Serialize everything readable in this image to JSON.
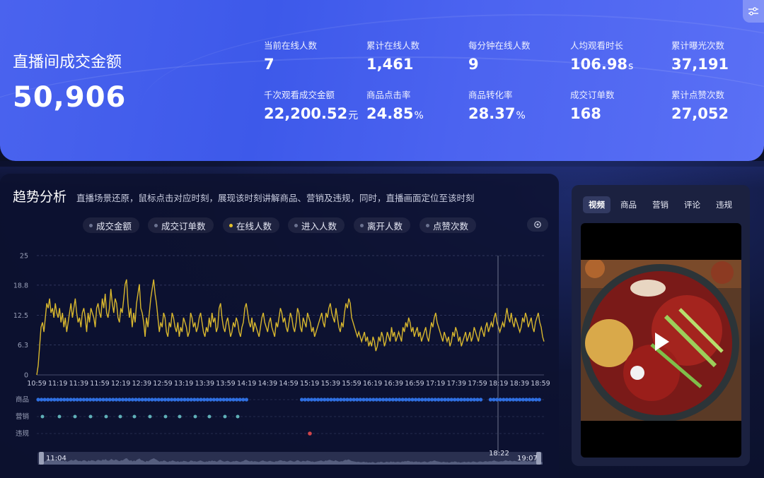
{
  "header": {
    "title": "直播间成交金额",
    "gmv": "50,906",
    "metrics": [
      {
        "label": "当前在线人数",
        "value": "7",
        "unit": ""
      },
      {
        "label": "累计在线人数",
        "value": "1,461",
        "unit": ""
      },
      {
        "label": "每分钟在线人数",
        "value": "9",
        "unit": ""
      },
      {
        "label": "人均观看时长",
        "value": "106.98",
        "unit": "s"
      },
      {
        "label": "累计曝光次数",
        "value": "37,191",
        "unit": ""
      },
      {
        "label": "千次观看成交金额",
        "value": "22,200.52",
        "unit": "元"
      },
      {
        "label": "商品点击率",
        "value": "24.85",
        "unit": "%"
      },
      {
        "label": "商品转化率",
        "value": "28.37",
        "unit": "%"
      },
      {
        "label": "成交订单数",
        "value": "168",
        "unit": ""
      },
      {
        "label": "累计点赞次数",
        "value": "27,052",
        "unit": ""
      }
    ]
  },
  "trend": {
    "title": "趋势分析",
    "description": "直播场景还原，鼠标点击对应时刻，展现该时刻讲解商品、营销及违规，同时，直播画面定位至该时刻",
    "legend": [
      {
        "label": "成交金额",
        "active": false
      },
      {
        "label": "成交订单数",
        "active": false
      },
      {
        "label": "在线人数",
        "active": true
      },
      {
        "label": "进入人数",
        "active": false
      },
      {
        "label": "离开人数",
        "active": false
      },
      {
        "label": "点赞次数",
        "active": false
      }
    ],
    "rows": [
      "商品",
      "营销",
      "违规"
    ],
    "cursor_time": "18:22",
    "range_start": "11:04",
    "range_end": "19:07"
  },
  "chart_data": {
    "type": "line",
    "series": [
      {
        "name": "在线人数",
        "color": "#d8b72e"
      }
    ],
    "x_ticks": [
      "10:59",
      "11:19",
      "11:39",
      "11:59",
      "12:19",
      "12:39",
      "12:59",
      "13:19",
      "13:39",
      "13:59",
      "14:19",
      "14:39",
      "14:59",
      "15:19",
      "15:39",
      "15:59",
      "16:19",
      "16:39",
      "16:59",
      "17:19",
      "17:39",
      "17:59",
      "18:19",
      "18:39",
      "18:59"
    ],
    "y_ticks": [
      "0",
      "6.3",
      "12.5",
      "18.8",
      "25"
    ],
    "ylim": [
      0,
      25
    ],
    "values": [
      0,
      2,
      6,
      10,
      11,
      9,
      12,
      15,
      14,
      16,
      13,
      14,
      12,
      15,
      13,
      12,
      14,
      11,
      13,
      10,
      12,
      9,
      11,
      13,
      15,
      12,
      14,
      16,
      13,
      11,
      12,
      10,
      13,
      14,
      12,
      9,
      13,
      11,
      14,
      13,
      12,
      10,
      14,
      15,
      13,
      12,
      16,
      14,
      17,
      13,
      12,
      14,
      18,
      15,
      13,
      16,
      15,
      12,
      11,
      14,
      13,
      16,
      19,
      20,
      15,
      12,
      14,
      10,
      13,
      11,
      15,
      17,
      19,
      14,
      13,
      11,
      8,
      12,
      10,
      13,
      16,
      18,
      20,
      17,
      15,
      12,
      9,
      11,
      10,
      13,
      12,
      9,
      8,
      11,
      10,
      13,
      12,
      10,
      9,
      11,
      8,
      10,
      9,
      12,
      11,
      10,
      8,
      9,
      13,
      12,
      10,
      11,
      9,
      10,
      12,
      13,
      11,
      9,
      8,
      10,
      9,
      12,
      10,
      13,
      11,
      12,
      9,
      10,
      14,
      15,
      12,
      10,
      9,
      11,
      12,
      10,
      8,
      9,
      11,
      10,
      12,
      11,
      9,
      8,
      10,
      11,
      14,
      15,
      13,
      11,
      10,
      12,
      9,
      11,
      10,
      9,
      8,
      10,
      12,
      13,
      11,
      10,
      9,
      11,
      12,
      10,
      9,
      8,
      11,
      10,
      12,
      14,
      13,
      11,
      12,
      10,
      9,
      11,
      13,
      12,
      10,
      9,
      11,
      14,
      13,
      10,
      9,
      12,
      11,
      10,
      13,
      12,
      11,
      9,
      10,
      8,
      9,
      10,
      11,
      12,
      13,
      11,
      10,
      13,
      12,
      14,
      15,
      13,
      12,
      11,
      14,
      12,
      10,
      9,
      11,
      10,
      13,
      15,
      14,
      16,
      15,
      12,
      11,
      10,
      9,
      8,
      9,
      8,
      7,
      8,
      9,
      7,
      8,
      6,
      7,
      6,
      8,
      7,
      5,
      6,
      8,
      7,
      9,
      8,
      6,
      7,
      9,
      8,
      7,
      10,
      8,
      9,
      7,
      8,
      9,
      8,
      7,
      10,
      9,
      11,
      10,
      12,
      11,
      9,
      10,
      8,
      9,
      10,
      8,
      9,
      7,
      8,
      9,
      10,
      8,
      7,
      9,
      11,
      10,
      12,
      13,
      11,
      10,
      9,
      8,
      7,
      9,
      8,
      7,
      8,
      6,
      7,
      9,
      8,
      10,
      9,
      7,
      8,
      6,
      7,
      8,
      9,
      7,
      8,
      9,
      7,
      8,
      10,
      9,
      8,
      7,
      9,
      10,
      9,
      8,
      10,
      11,
      9,
      10,
      11,
      10,
      12,
      13,
      11,
      10,
      9,
      10,
      11,
      10,
      12,
      14,
      12,
      11,
      13,
      11,
      10,
      12,
      11,
      10,
      9,
      10,
      12,
      11,
      13,
      12,
      10,
      11,
      12,
      10,
      9,
      11,
      12,
      13,
      11,
      10,
      8,
      7
    ]
  },
  "markers": {
    "goods_color": "#2f6fe0",
    "marketing_color": "#5fb0b8",
    "violation_color": "#d0454a"
  },
  "video": {
    "tabs": [
      {
        "label": "视频",
        "active": true
      },
      {
        "label": "商品",
        "active": false
      },
      {
        "label": "营销",
        "active": false
      },
      {
        "label": "评论",
        "active": false
      },
      {
        "label": "违规",
        "active": false
      }
    ]
  }
}
